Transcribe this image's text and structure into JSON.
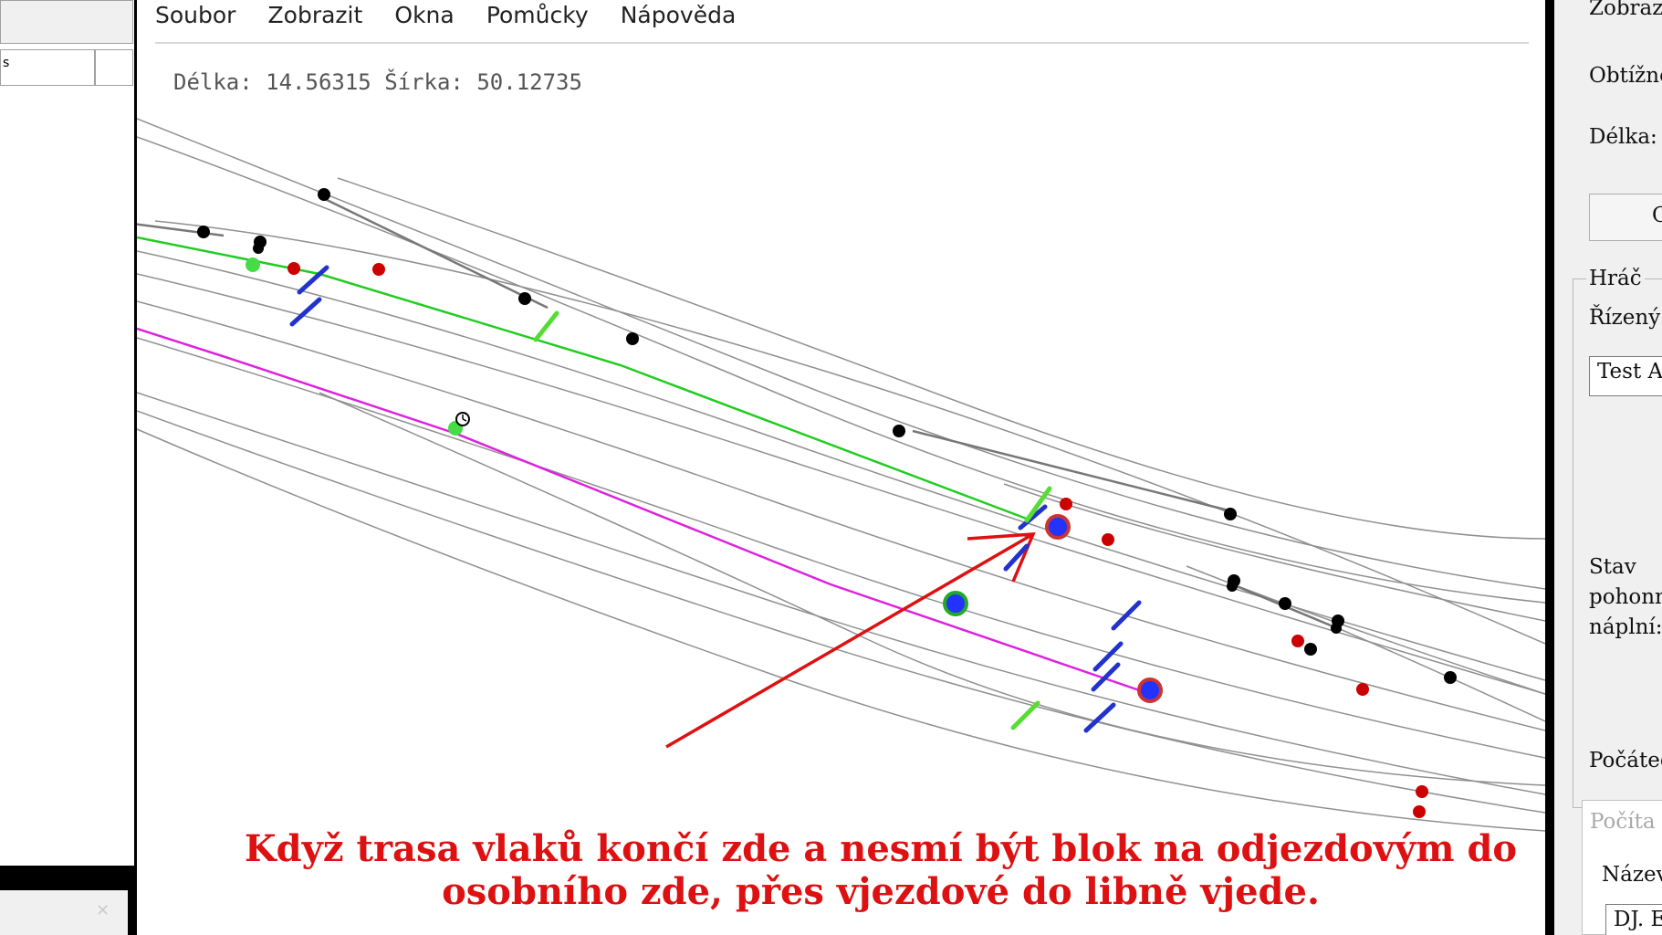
{
  "menu": {
    "items": [
      "Soubor",
      "Zobrazit",
      "Okna",
      "Pomůcky",
      "Nápověda"
    ]
  },
  "left_panel": {
    "cell_text": "s"
  },
  "map": {
    "coords": "Délka: 14.56315 Šírka: 50.12735"
  },
  "caption": {
    "line1": "Když trasa vlaků končí zde a nesmí být blok na odjezdovým do",
    "line2": "osobního zde, přes vjezdové do libně vjede."
  },
  "right_panel": {
    "label_zobrazit": "Zobrazo",
    "label_obtiznost": "Obtížno",
    "label_delka": "Délka:",
    "button_c": "C",
    "group_hrac": "Hráč",
    "label_rizeny": "Řízený",
    "input_value": "Test A",
    "label_stav": "Stav",
    "label_pohon": "pohonn",
    "label_napln": "náplní:",
    "label_pocatec": "Počáteč",
    "popup_title": "Počíta",
    "label_nazev": "Název",
    "input2_value": "DJ. E"
  },
  "colors": {
    "accent_red": "#dd1111",
    "route_green": "#22cc22",
    "route_magenta": "#dd22dd",
    "block_blue": "#2233cc",
    "signal_red": "#cc0000"
  }
}
